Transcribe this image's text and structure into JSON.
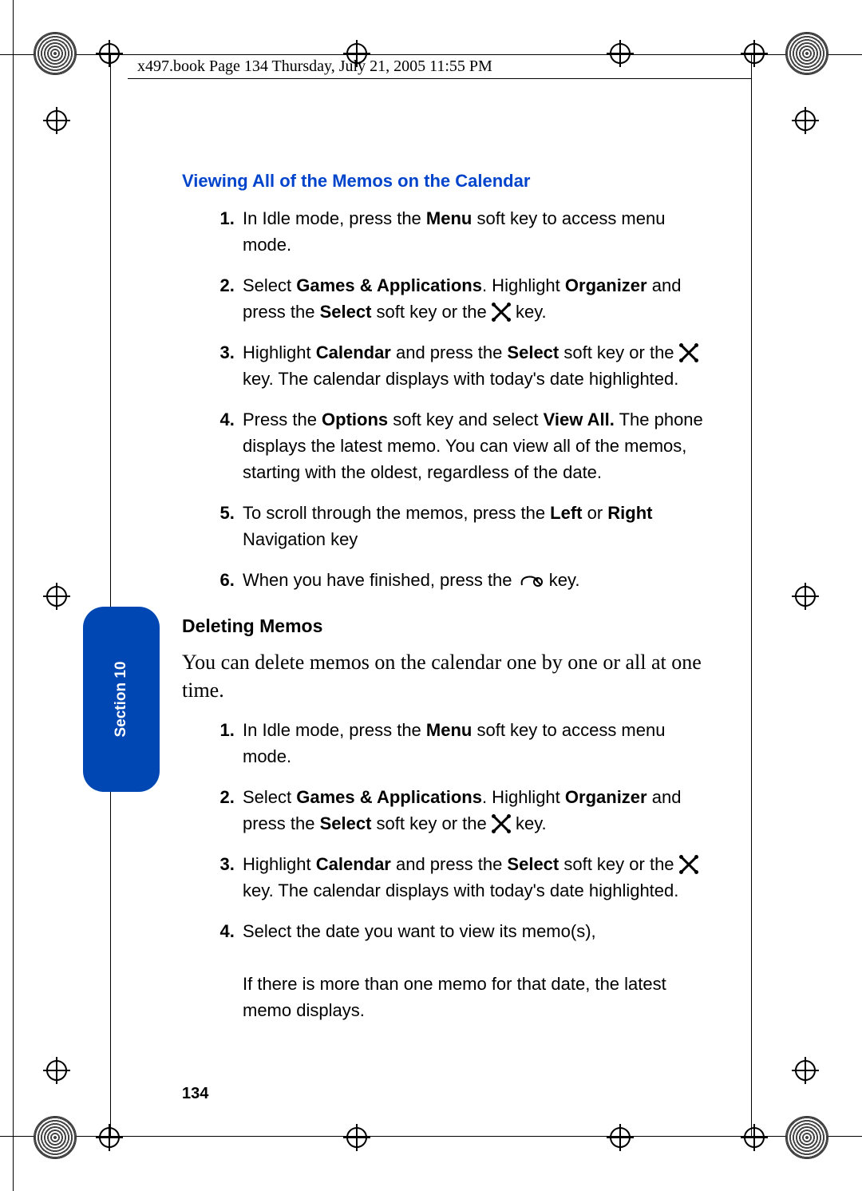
{
  "header": "x497.book  Page 134  Thursday, July 21, 2005  11:55 PM",
  "section_tab": "Section 10",
  "page_number": "134",
  "section1": {
    "title": "Viewing All of the Memos on the Calendar",
    "steps": {
      "s1a": "In Idle mode, press the ",
      "s1b": " soft key to access menu mode.",
      "menu": "Menu",
      "s2a": "Select ",
      "games": "Games & Applications",
      "s2b": ". Highlight ",
      "organizer": "Organizer",
      "s2c": " and press the ",
      "select": "Select",
      "s2d": " soft key or the ",
      "s2e": " key.",
      "s3a": "Highlight ",
      "calendar": "Calendar",
      "s3b": " and press the ",
      "s3c": " soft key or the ",
      "s3d": " key. The calendar displays with today's date highlighted.",
      "s4a": "Press the ",
      "options": "Options",
      "s4b": " soft key and select ",
      "viewall": "View All.",
      "s4c": " The phone displays the latest memo. You can view all of the memos, starting with the oldest, regardless of the date.",
      "s5a": "To scroll through the memos, press the ",
      "left": "Left",
      "s5b": " or ",
      "right": "Right",
      "s5c": " Navigation key",
      "s6a": "When you have finished, press the ",
      "s6b": " key."
    }
  },
  "section2": {
    "title": "Deleting Memos",
    "intro": "You can delete memos on the calendar one by one or all at one time.",
    "steps": {
      "s1a": "In Idle mode, press the ",
      "menu": "Menu",
      "s1b": " soft key to access menu mode.",
      "s2a": "Select ",
      "games": "Games & Applications",
      "s2b": ". Highlight ",
      "organizer": "Organizer",
      "s2c": " and press the ",
      "select": "Select",
      "s2d": " soft key or the ",
      "s2e": " key.",
      "s3a": "Highlight ",
      "calendar": "Calendar",
      "s3b": " and press the ",
      "s3c": " soft key or the ",
      "s3d": " key. The calendar displays with today's date highlighted.",
      "s4a": "Select the date you want to view its memo(s),",
      "s4b": "If there is more than one memo for that date, the latest memo displays."
    }
  }
}
